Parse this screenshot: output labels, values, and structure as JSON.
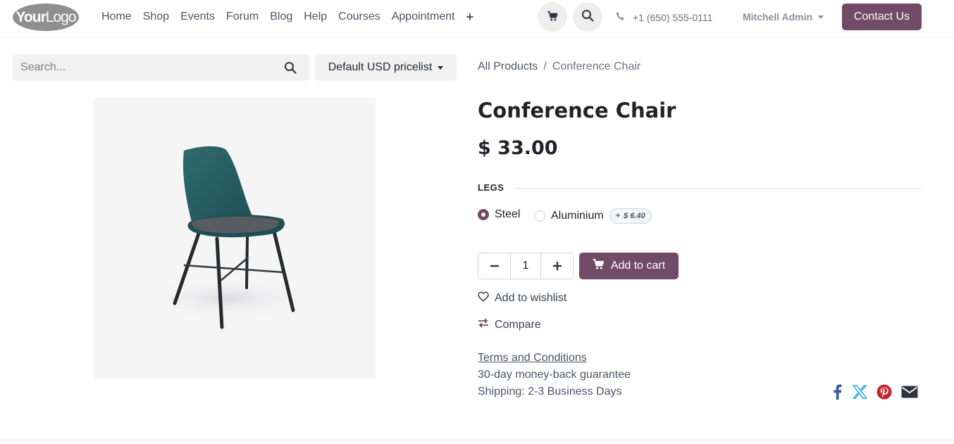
{
  "header": {
    "logo": {
      "bold": "Your",
      "light": "Logo"
    },
    "nav": [
      "Home",
      "Shop",
      "Events",
      "Forum",
      "Blog",
      "Help",
      "Courses",
      "Appointment"
    ],
    "nav_more": "+",
    "phone": "+1 (650) 555-0111",
    "user": "Mitchell Admin",
    "contact_button": "Contact Us"
  },
  "search": {
    "placeholder": "Search..."
  },
  "pricelist": {
    "label": "Default USD pricelist"
  },
  "breadcrumb": {
    "parent": "All Products",
    "separator": "/",
    "current": "Conference Chair"
  },
  "product": {
    "name": "Conference Chair",
    "price": "$ 33.00",
    "attribute": {
      "label": "LEGS",
      "options": [
        {
          "label": "Steel",
          "checked": true
        },
        {
          "label": "Aluminium",
          "checked": false,
          "extra_sign": "+",
          "extra_price": "$ 6.40"
        }
      ]
    },
    "quantity": "1",
    "add_to_cart": "Add to cart",
    "wishlist": "Add to wishlist",
    "compare": "Compare",
    "terms": "Terms and Conditions",
    "guarantee": "30-day money-back guarantee",
    "shipping": "Shipping: 2-3 Business Days"
  },
  "colors": {
    "brand": "#714b67",
    "facebook": "#3b5998",
    "x": "#1da1f2",
    "pinterest": "#c8232c",
    "email": "#2f3440"
  },
  "icons": [
    "cart-icon",
    "search-icon",
    "phone-icon",
    "heart-icon",
    "compare-icon",
    "facebook-icon",
    "x-icon",
    "pinterest-icon",
    "email-icon"
  ]
}
